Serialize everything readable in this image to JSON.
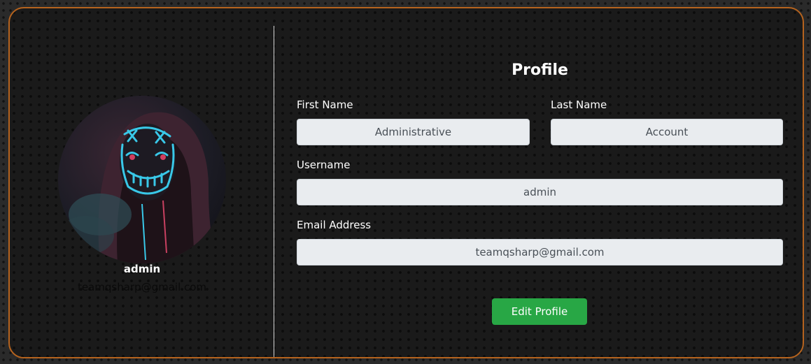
{
  "sidebar": {
    "avatar_alt": "profile picture",
    "name": "admin",
    "email": "teamqsharp@gmail.com"
  },
  "form": {
    "title": "Profile",
    "first_name_label": "First Name",
    "first_name_value": "Administrative",
    "last_name_label": "Last Name",
    "last_name_value": "Account",
    "username_label": "Username",
    "username_value": "admin",
    "email_label": "Email Address",
    "email_value": "teamqsharp@gmail.com",
    "edit_button_label": "Edit Profile"
  },
  "colors": {
    "card_border": "#b5631e",
    "button_green": "#28a745",
    "input_background": "#e9ecef",
    "neon_mask": "#39c8e8"
  }
}
